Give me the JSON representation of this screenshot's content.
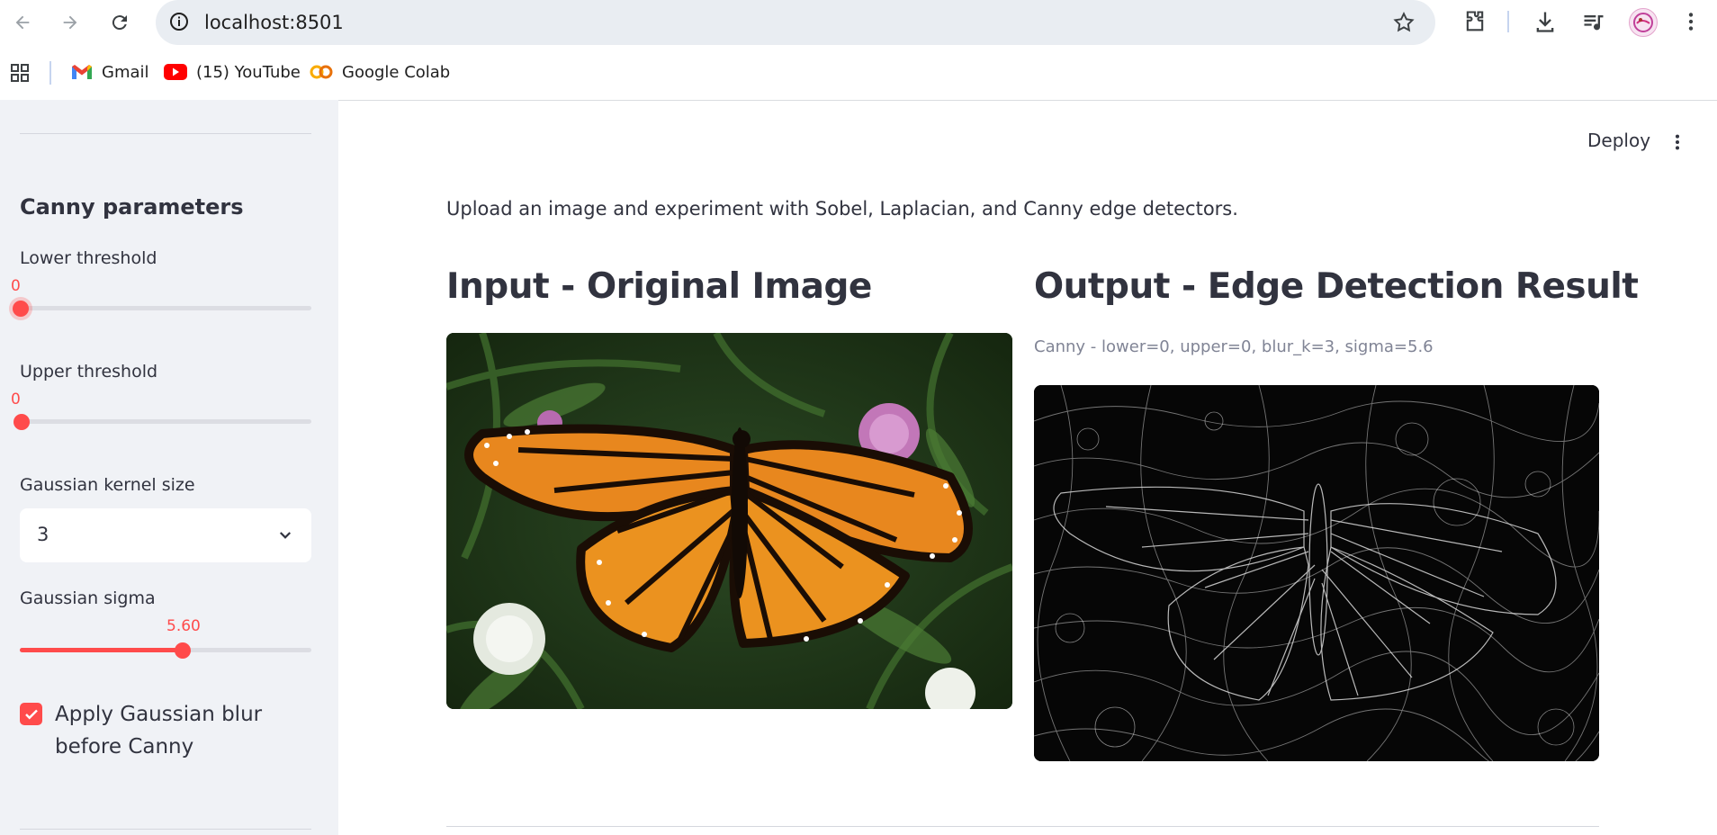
{
  "browser": {
    "url": "localhost:8501",
    "bookmarks": [
      {
        "label": "Gmail",
        "icon": "gmail-icon"
      },
      {
        "label": "(15) YouTube",
        "icon": "youtube-icon"
      },
      {
        "label": "Google Colab",
        "icon": "colab-icon"
      }
    ]
  },
  "sidebar": {
    "section_title": "Canny parameters",
    "lower": {
      "label": "Lower threshold",
      "value": "0",
      "fraction": 0.0
    },
    "upper": {
      "label": "Upper threshold",
      "value": "0",
      "fraction": 0.0
    },
    "kernel": {
      "label": "Gaussian kernel size",
      "value": "3"
    },
    "sigma": {
      "label": "Gaussian sigma",
      "value": "5.60",
      "fraction": 0.56
    },
    "blur": {
      "label": "Apply Gaussian blur before Canny",
      "checked": true
    }
  },
  "header": {
    "deploy_label": "Deploy"
  },
  "main": {
    "intro": "Upload an image and experiment with Sobel, Laplacian, and Canny edge detectors.",
    "input_title": "Input - Original Image",
    "output_title": "Output - Edge Detection Result",
    "output_caption": "Canny - lower=0, upper=0, blur_k=3, sigma=5.6"
  },
  "colors": {
    "accent": "#ff4b4b",
    "sidebar_bg": "#f0f2f6",
    "text": "#31333f"
  }
}
